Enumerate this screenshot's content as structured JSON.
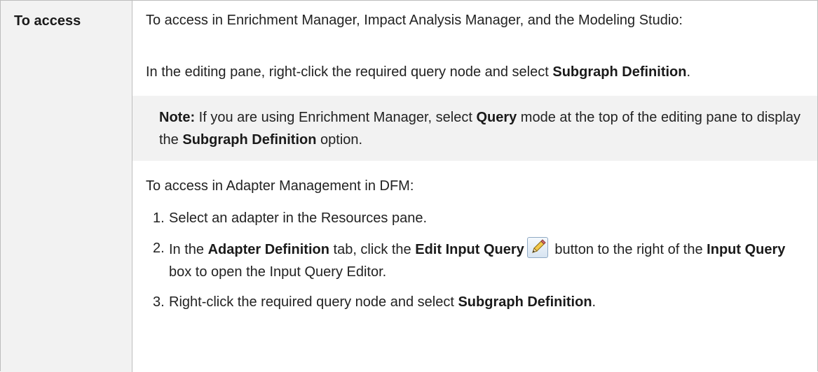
{
  "label": "To access",
  "intro": {
    "line1": "To access in Enrichment Manager, Impact Analysis Manager, and the Modeling Studio:",
    "line2_pre": "In the editing pane, right-click the required query node and select ",
    "line2_bold": "Subgraph Definition",
    "line2_post": "."
  },
  "note": {
    "label": "Note:",
    "text1": " If you are using Enrichment Manager, select ",
    "bold1": "Query",
    "text2": " mode at the top of the editing pane to display the ",
    "bold2": "Subgraph Definition",
    "text3": " option."
  },
  "dfm_intro": "To access in Adapter Management in DFM:",
  "steps": [
    {
      "num": "1.",
      "text": "Select an adapter in the Resources pane."
    },
    {
      "num": "2.",
      "t1": "In the ",
      "b1": "Adapter Definition",
      "t2": " tab, click the ",
      "b2": "Edit Input Query",
      "t3": " button to the right of the ",
      "b3": "Input Query",
      "t4": " box to open the Input Query Editor.",
      "icon": "edit-pencil-icon"
    },
    {
      "num": "3.",
      "t1": "Right-click the required query node and select ",
      "b1": "Subgraph Definition",
      "t2": "."
    }
  ]
}
